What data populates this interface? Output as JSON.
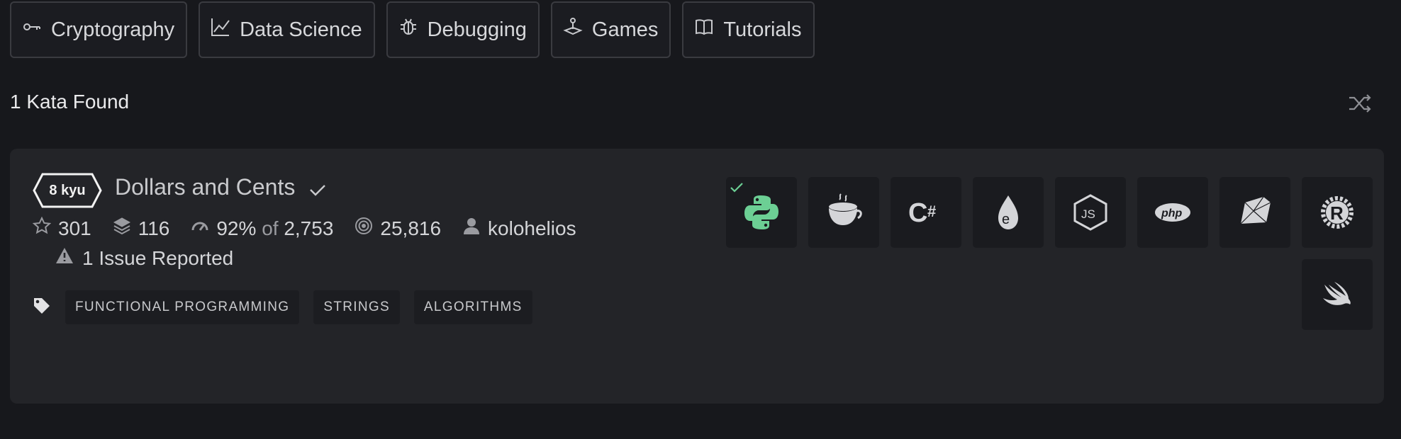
{
  "categories": [
    {
      "label": "Cryptography",
      "icon": "key-icon"
    },
    {
      "label": "Data Science",
      "icon": "chart-line-icon"
    },
    {
      "label": "Debugging",
      "icon": "bug-icon"
    },
    {
      "label": "Games",
      "icon": "joystick-icon"
    },
    {
      "label": "Tutorials",
      "icon": "book-icon"
    }
  ],
  "results": {
    "found_label": "1 Kata Found",
    "shuffle_icon": "shuffle-icon"
  },
  "kata": {
    "rank": "8 kyu",
    "title": "Dollars and Cents",
    "stars": "301",
    "collections": "116",
    "satisfaction": "92%",
    "of_label": "of",
    "votes": "2,753",
    "completed": "25,816",
    "author": "kolohelios",
    "issues": "1 Issue Reported",
    "tags": [
      "FUNCTIONAL PROGRAMMING",
      "STRINGS",
      "ALGORITHMS"
    ],
    "languages": [
      {
        "name": "python",
        "icon": "python-icon",
        "completed": true
      },
      {
        "name": "coffeescript",
        "icon": "coffeescript-icon",
        "completed": false
      },
      {
        "name": "csharp",
        "icon": "csharp-icon",
        "completed": false
      },
      {
        "name": "elixir",
        "icon": "elixir-icon",
        "completed": false
      },
      {
        "name": "javascript",
        "icon": "nodejs-icon",
        "completed": false
      },
      {
        "name": "php",
        "icon": "php-icon",
        "completed": false
      },
      {
        "name": "ruby",
        "icon": "ruby-icon",
        "completed": false
      },
      {
        "name": "rust",
        "icon": "rust-icon",
        "completed": false
      },
      {
        "name": "swift",
        "icon": "swift-icon",
        "completed": false
      }
    ]
  },
  "colors": {
    "background": "#17181c",
    "card": "#232428",
    "accent_green": "#6ccf94"
  }
}
